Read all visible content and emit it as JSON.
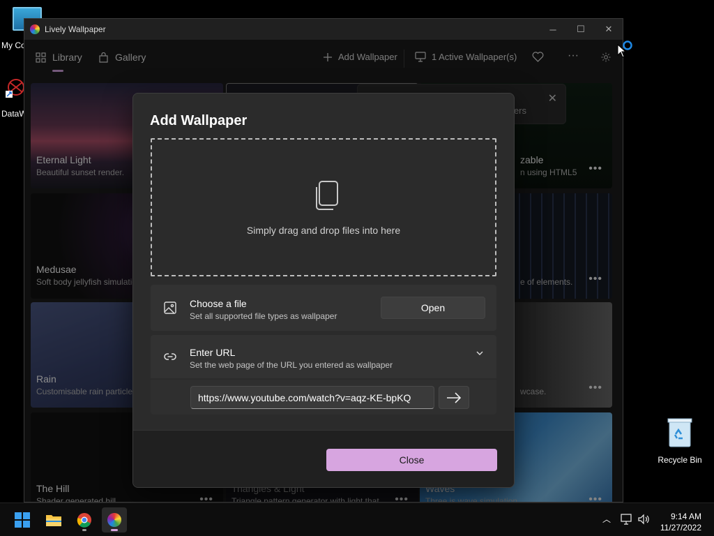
{
  "desktop": {
    "icons": [
      {
        "label": "My Co"
      },
      {
        "label": "DataW"
      },
      {
        "label": "Recycle Bin"
      }
    ]
  },
  "window": {
    "title": "Lively Wallpaper",
    "controls": {
      "minimize": "─",
      "maximize": "☐",
      "close": "✕"
    }
  },
  "nav": {
    "tabs": [
      {
        "label": "Library",
        "icon": "grid-icon"
      },
      {
        "label": "Gallery",
        "icon": "bag-icon"
      }
    ],
    "add_wallpaper": "Add Wallpaper",
    "active_wallpapers": "1 Active Wallpaper(s)",
    "more": "···"
  },
  "cards": [
    {
      "title": "Eternal Light",
      "desc": "Beautiful sunset render."
    },
    {
      "title": "Medusae",
      "desc": "Soft body jellyfish simulatio"
    },
    {
      "title": "Rain",
      "desc": "Customisable rain particles"
    },
    {
      "title": "The Hill",
      "desc": "Shader generated hill."
    },
    {
      "title": "Triangles & Light",
      "desc": "Triangle pattern generator with light that"
    },
    {
      "title": "zable",
      "desc": "n using HTML5"
    },
    {
      "title": "",
      "desc": "e of elements."
    },
    {
      "title": "",
      "desc": "wcase."
    },
    {
      "title": "Waves",
      "desc": "Three.js wave simulation."
    }
  ],
  "toast": {
    "text": "ers"
  },
  "dialog": {
    "title": "Add Wallpaper",
    "dropzone_text": "Simply drag and drop files into here",
    "choose_file": {
      "title": "Choose a file",
      "desc": "Set all supported file types as wallpaper",
      "button": "Open"
    },
    "enter_url": {
      "title": "Enter URL",
      "desc": "Set the web page of the URL you entered as wallpaper",
      "value": "https://www.youtube.com/watch?v=aqz-KE-bpKQ"
    },
    "close_button": "Close",
    "accent": "#d7a5e0"
  },
  "taskbar": {
    "time": "9:14 AM",
    "date": "11/27/2022"
  }
}
